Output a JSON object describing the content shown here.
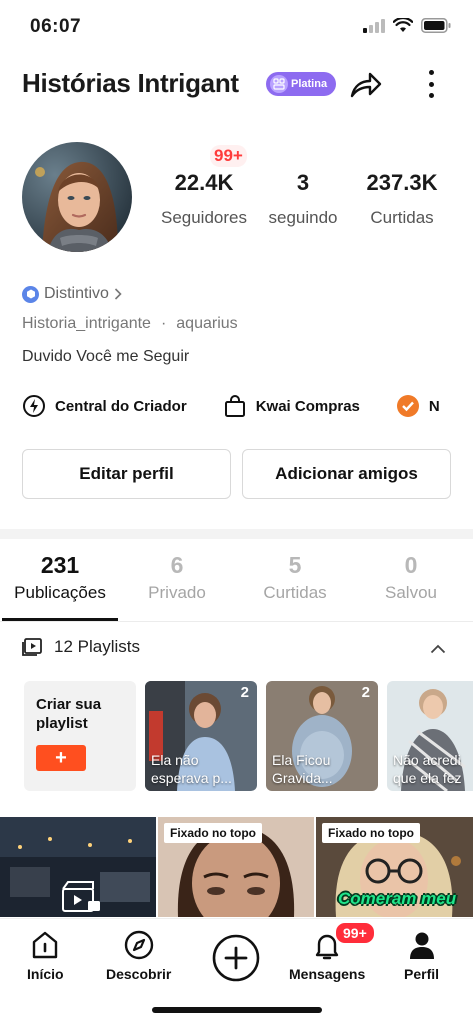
{
  "status_bar": {
    "time": "06:07"
  },
  "header": {
    "name": "Histórias Intrigant",
    "badge_label": "Platina"
  },
  "notification_badge": "99+",
  "stats": [
    {
      "value": "22.4K",
      "label": "Seguidores"
    },
    {
      "value": "3",
      "label": "seguindo"
    },
    {
      "value": "237.3K",
      "label": "Curtidas"
    }
  ],
  "profile": {
    "distintivo": "Distintivo",
    "username": "Historia_intrigante",
    "sign": "aquarius",
    "bio": "Duvido Você me Seguir"
  },
  "quick_links": [
    {
      "label": "Central do Criador",
      "icon": "bolt-icon"
    },
    {
      "label": "Kwai Compras",
      "icon": "shopping-bag-icon"
    },
    {
      "label": "N",
      "icon": "orange-check-icon"
    }
  ],
  "buttons": {
    "edit": "Editar perfil",
    "add_friends": "Adicionar amigos"
  },
  "tabs": [
    {
      "num": "231",
      "label": "Publicações"
    },
    {
      "num": "6",
      "label": "Privado"
    },
    {
      "num": "5",
      "label": "Curtidas"
    },
    {
      "num": "0",
      "label": "Salvou"
    }
  ],
  "playlists": {
    "title": "12 Playlists",
    "create_label": "Criar sua playlist",
    "create_plus": "+",
    "items": [
      {
        "count": "2",
        "caption": "Ela não esperava p..."
      },
      {
        "count": "2",
        "caption": "Ela Ficou Gravida..."
      },
      {
        "count": "",
        "caption": "Não acredi que ela fez"
      }
    ]
  },
  "videos": [
    {
      "pinned": ""
    },
    {
      "pinned": "Fixado no topo"
    },
    {
      "pinned": "Fixado no topo",
      "overlay": "Comeram meu"
    }
  ],
  "bottom_nav": [
    {
      "label": "Início",
      "icon": "home-icon"
    },
    {
      "label": "Descobrir",
      "icon": "compass-icon"
    },
    {
      "label": "",
      "icon": "plus-circle-icon"
    },
    {
      "label": "Mensagens",
      "icon": "bell-icon"
    },
    {
      "label": "Perfil",
      "icon": "person-icon"
    }
  ],
  "messages_badge": "99+",
  "colors": {
    "accent": "#ff4f1f",
    "badge_purple": "#8d6bf0",
    "notif_red": "#ff2d3a"
  }
}
